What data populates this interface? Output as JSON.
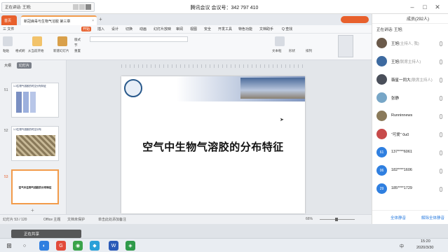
{
  "meeting": {
    "speaker": "正在讲话: 王旭;",
    "title": "腾讯会议  会议号：342 797 410",
    "members_title": "成员(292人)",
    "now_speaking": "正在讲话: 王旭;"
  },
  "wps": {
    "tabs": [
      "首页",
      "新冠病毒与生物气溶胶 第三章"
    ],
    "menu": [
      "三 文件",
      "开始",
      "插入",
      "设计",
      "切换",
      "动画",
      "幻灯片放映",
      "审阅",
      "视图",
      "安全",
      "开发工具",
      "特色功能",
      "文档助手",
      "Q 查找"
    ],
    "ribbon": {
      "paste": "粘贴",
      "format": "格式刷",
      "from_start": "从当前开始",
      "new_slide": "新建幻灯片",
      "layout": "版式",
      "section": "节",
      "reset": "重置",
      "textbox": "文本框",
      "shape": "形状",
      "arrange": "排列",
      "outline": "大纲",
      "slides": "幻灯片"
    },
    "slides": [
      {
        "num": "51",
        "title": "1.3生物气溶胶的时空分布特征"
      },
      {
        "num": "52",
        "title": "1.3生物气溶胶的时空分布"
      },
      {
        "num": "53",
        "title": "空气中生物气溶胶的分布特征"
      }
    ],
    "slide_main_title": "空气中生物气溶胶的分布特征",
    "status": {
      "slide_count": "幻灯片 53 / 120",
      "theme": "Office 主题",
      "protect": "文档未保护",
      "notes": "单击此处添加备注",
      "zoom": "66%"
    },
    "share_banner": "正在共享"
  },
  "members": [
    {
      "name": "王旭",
      "role": "(主持人, 我)",
      "color": "#6b5a4a"
    },
    {
      "name": "王旭",
      "role": "(联席主持人)",
      "color": "#3d6aa0"
    },
    {
      "name": "薇星一同大",
      "role": "(联席主持人)",
      "color": "#4a4f5a"
    },
    {
      "name": "张静",
      "role": "",
      "color": "#77a6c7"
    },
    {
      "name": "Runninnews",
      "role": "",
      "color": "#8a7a5a"
    },
    {
      "name": "“可爱” 0u0",
      "role": "",
      "color": "#c74a4a"
    },
    {
      "name": "137****6061",
      "role": "",
      "color": "#2f7fe0",
      "badge": "61"
    },
    {
      "name": "182****1606",
      "role": "",
      "color": "#2f7fe0",
      "badge": "06"
    },
    {
      "name": "185****1729",
      "role": "",
      "color": "#2f7fe0",
      "badge": "29"
    }
  ],
  "member_actions": {
    "mute_all": "全体静音",
    "unmute_all": "解除全体静音"
  },
  "taskbar": {
    "time": "15:20",
    "date": "2020/3/30",
    "lang": "中"
  },
  "colors": {
    "accent_blue": "#2f7fe0",
    "wps_orange": "#e8602c",
    "tab_active": "#f29b4a"
  }
}
